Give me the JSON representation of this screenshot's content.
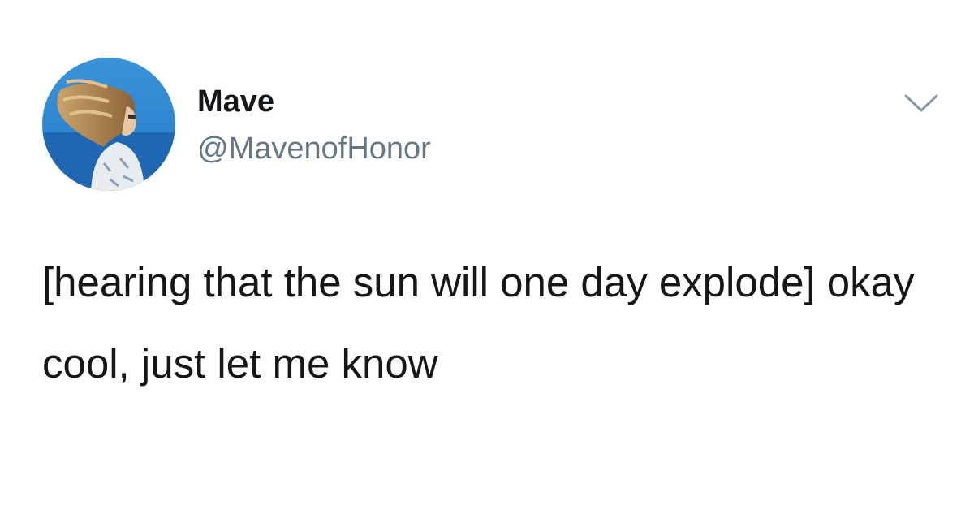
{
  "tweet": {
    "display_name": "Mave",
    "handle": "@MavenofHonor",
    "text": "[hearing that the sun will one day explode] okay cool, just let me know"
  },
  "icons": {
    "avatar": "profile-photo",
    "menu": "chevron-down-icon"
  },
  "colors": {
    "primary_text": "#14171a",
    "secondary_text": "#657786",
    "chevron": "#8899a6",
    "background": "#ffffff"
  }
}
